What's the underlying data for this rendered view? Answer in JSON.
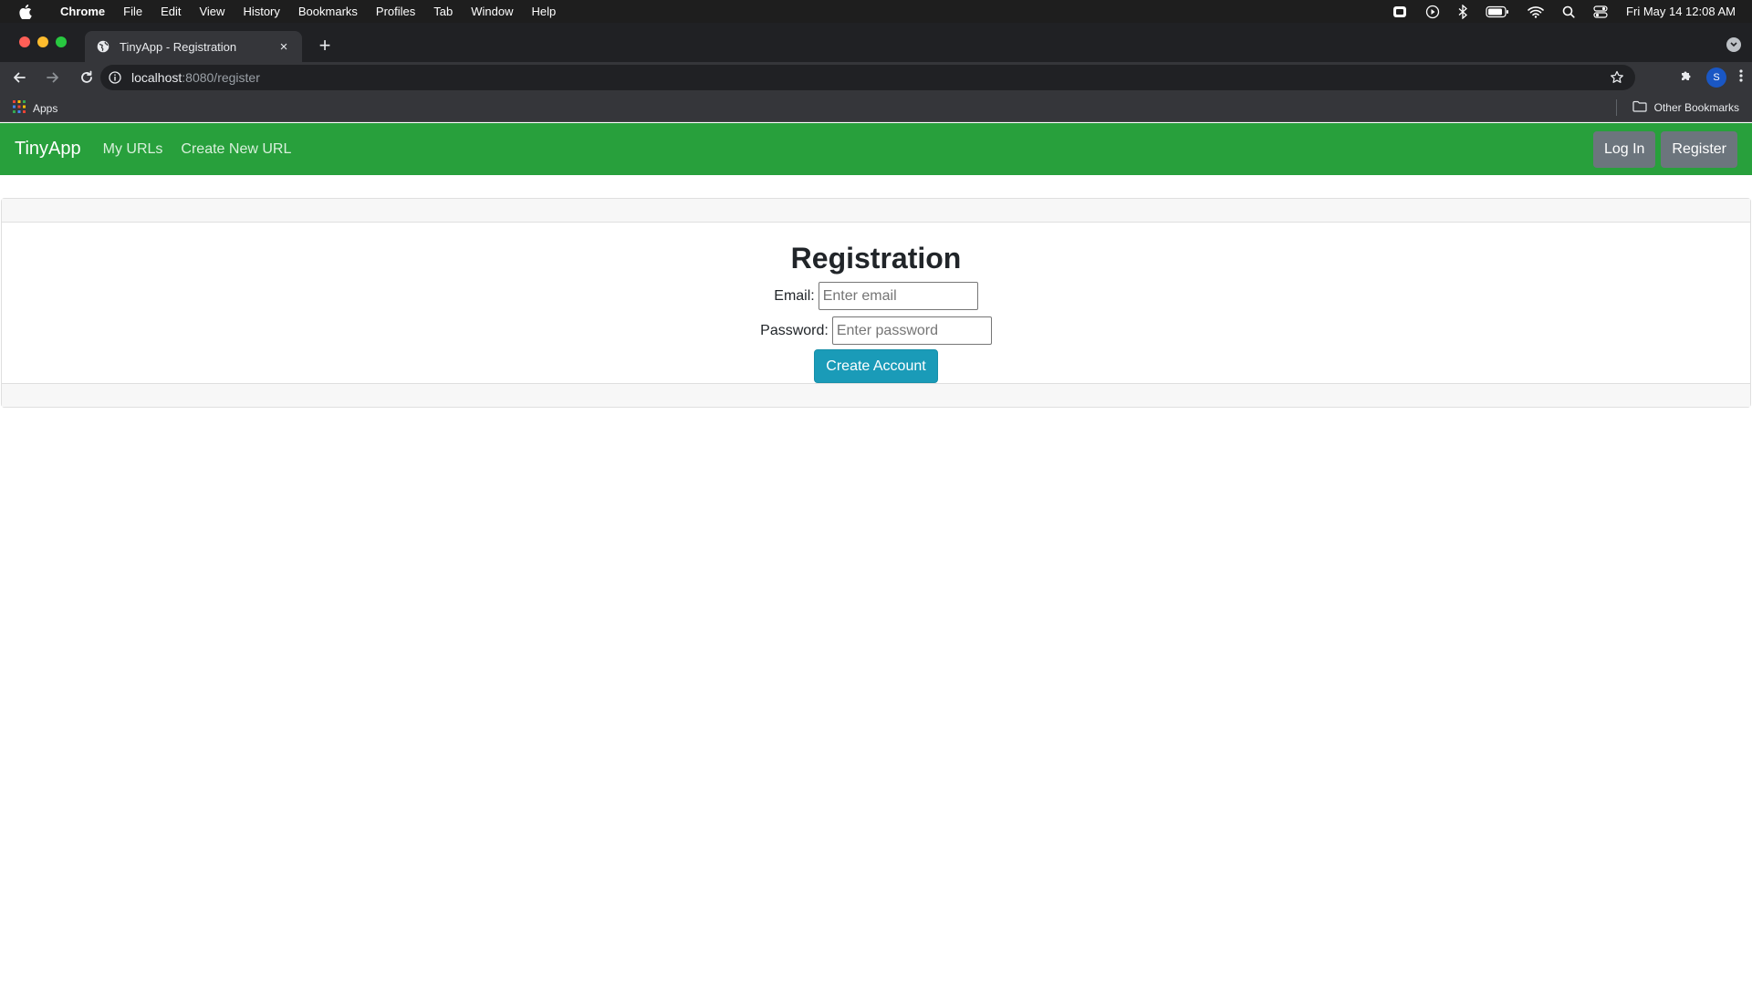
{
  "menubar": {
    "apple_icon": "apple-icon",
    "app_name": "Chrome",
    "items": [
      "File",
      "Edit",
      "View",
      "History",
      "Bookmarks",
      "Profiles",
      "Tab",
      "Window",
      "Help"
    ],
    "clock": "Fri May 14  12:08 AM"
  },
  "browser": {
    "tab_title": "TinyApp - Registration",
    "new_tab_symbol": "+",
    "close_symbol": "×",
    "url_host": "localhost",
    "url_path": ":8080/register",
    "profile_initial": "S",
    "bookmarks": {
      "apps_label": "Apps",
      "other_label": "Other Bookmarks"
    }
  },
  "app": {
    "brand": "TinyApp",
    "nav_links": [
      "My URLs",
      "Create New URL"
    ],
    "login_label": "Log In",
    "register_label": "Register",
    "nav_color": "#28a03c"
  },
  "form": {
    "heading": "Registration",
    "email_label": "Email:",
    "email_placeholder": "Enter email",
    "email_value": "",
    "password_label": "Password:",
    "password_placeholder": "Enter password",
    "password_value": "",
    "submit_label": "Create Account",
    "submit_color": "#1a9bb8"
  }
}
